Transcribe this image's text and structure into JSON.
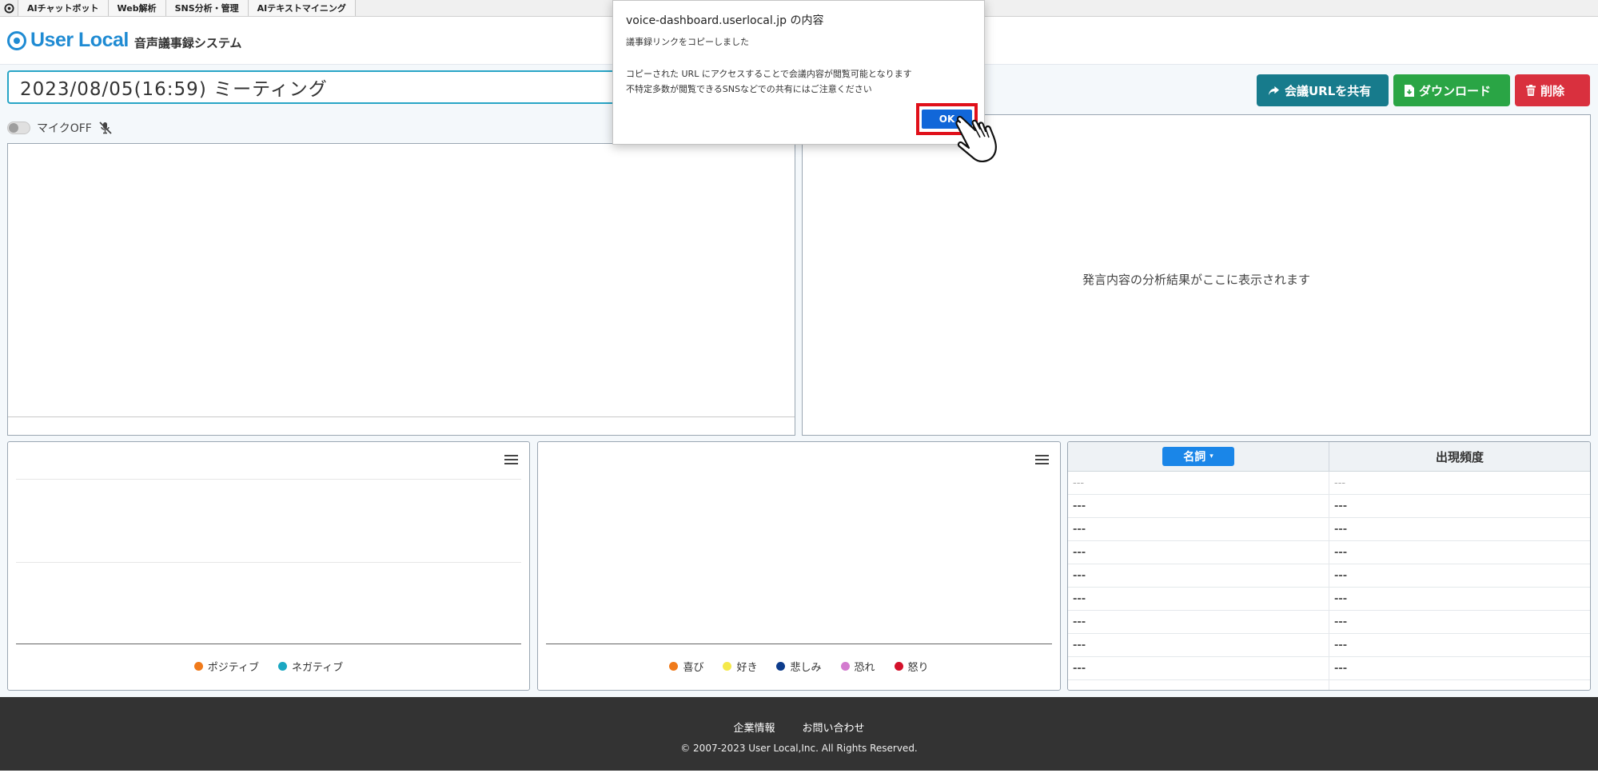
{
  "topbar": {
    "tabs": [
      "AIチャットボット",
      "Web解析",
      "SNS分析・管理",
      "AIテキストマイニング"
    ]
  },
  "header": {
    "brand": "User Local",
    "subtitle": "音声議事録システム"
  },
  "meeting": {
    "title": "2023/08/05(16:59) ミーティング"
  },
  "actions": {
    "share_label": "会議URLを共有",
    "download_label": "ダウンロード",
    "delete_label": "削除"
  },
  "mic": {
    "label": "マイクOFF"
  },
  "analysis": {
    "placeholder": "発言内容の分析結果がここに表示されます"
  },
  "sentiment_legend": {
    "items": [
      {
        "label": "ポジティブ",
        "color": "#f07a1a"
      },
      {
        "label": "ネガティブ",
        "color": "#1aa7c2"
      }
    ]
  },
  "emotion_legend": {
    "items": [
      {
        "label": "喜び",
        "color": "#f07a1a"
      },
      {
        "label": "好き",
        "color": "#f5e94a"
      },
      {
        "label": "悲しみ",
        "color": "#0d3c8c"
      },
      {
        "label": "恐れ",
        "color": "#d37bcf"
      },
      {
        "label": "怒り",
        "color": "#d4112b"
      }
    ]
  },
  "frequency_table": {
    "pos_dropdown": "名詞",
    "freq_header": "出現頻度",
    "rows": [
      [
        "---",
        "---"
      ],
      [
        "---",
        "---"
      ],
      [
        "---",
        "---"
      ],
      [
        "---",
        "---"
      ],
      [
        "---",
        "---"
      ],
      [
        "---",
        "---"
      ],
      [
        "---",
        "---"
      ],
      [
        "---",
        "---"
      ],
      [
        "---",
        "---"
      ],
      [
        "---",
        "---"
      ]
    ]
  },
  "footer": {
    "company_link": "企業情報",
    "contact_link": "お問い合わせ",
    "copyright": "© 2007-2023 User Local,Inc. All Rights Reserved."
  },
  "dialog": {
    "title": "voice-dashboard.userlocal.jp の内容",
    "message": "議事録リンクをコピーしました",
    "note_line1": "コピーされた URL にアクセスすることで会議内容が閲覧可能となります",
    "note_line2": "不特定多数が閲覧できるSNSなどでの共有にはご注意ください",
    "ok_label": "OK"
  }
}
